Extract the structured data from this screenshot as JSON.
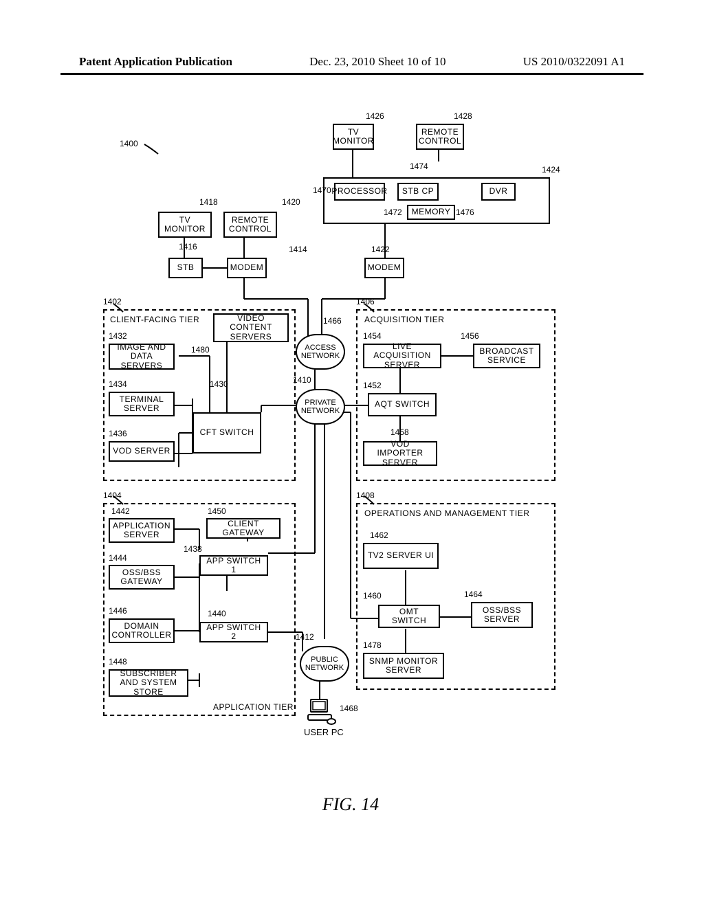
{
  "header": {
    "left": "Patent Application Publication",
    "middle": "Dec. 23, 2010  Sheet 10 of 10",
    "right": "US 2010/0322091 A1"
  },
  "figure_caption": "FIG. 14",
  "refs": {
    "r1400": "1400",
    "r1402": "1402",
    "r1404": "1404",
    "r1406": "1406",
    "r1408": "1408",
    "r1410": "1410",
    "r1412": "1412",
    "r1414": "1414",
    "r1416": "1416",
    "r1418": "1418",
    "r1420": "1420",
    "r1422": "1422",
    "r1424": "1424",
    "r1426": "1426",
    "r1428": "1428",
    "r1430": "1430",
    "r1432": "1432",
    "r1434": "1434",
    "r1436": "1436",
    "r1438": "1438",
    "r1440": "1440",
    "r1442": "1442",
    "r1444": "1444",
    "r1446": "1446",
    "r1448": "1448",
    "r1450": "1450",
    "r1452": "1452",
    "r1454": "1454",
    "r1456": "1456",
    "r1458": "1458",
    "r1460": "1460",
    "r1462": "1462",
    "r1464": "1464",
    "r1466": "1466",
    "r1468": "1468",
    "r1470": "1470",
    "r1472": "1472",
    "r1474": "1474",
    "r1476": "1476",
    "r1478": "1478",
    "r1480": "1480"
  },
  "boxes": {
    "tv_monitor_1": "TV MONITOR",
    "remote_control_1": "REMOTE CONTROL",
    "stb": "STB",
    "modem_1": "MODEM",
    "modem_2": "MODEM",
    "tv_monitor_2": "TV MONITOR",
    "remote_control_2": "REMOTE CONTROL",
    "processor": "PROCESSOR",
    "stb_cp": "STB CP",
    "dvr": "DVR",
    "memory": "MEMORY",
    "video_content_servers": "VIDEO CONTENT SERVERS",
    "image_and_data_servers": "IMAGE AND DATA SERVERS",
    "terminal_server": "TERMINAL SERVER",
    "vod_server": "VOD SERVER",
    "cft_switch": "CFT SWITCH",
    "live_acquisition_server": "LIVE ACQUISITION SERVER",
    "broadcast_service": "BROADCAST SERVICE",
    "aqt_switch": "AQT SWITCH",
    "vod_importer_server": "VOD IMPORTER SERVER",
    "application_server": "APPLICATION SERVER",
    "client_gateway": "CLIENT GATEWAY",
    "oss_bss_gateway": "OSS/BSS GATEWAY",
    "app_switch_1": "APP SWITCH 1",
    "domain_controller": "DOMAIN CONTROLLER",
    "app_switch_2": "APP SWITCH 2",
    "subscriber_and_system_store": "SUBSCRIBER AND SYSTEM STORE",
    "tv2_server_ui": "TV2 SERVER UI",
    "omt_switch": "OMT SWITCH",
    "oss_bss_server": "OSS/BSS SERVER",
    "snmp_monitor_server": "SNMP MONITOR SERVER",
    "user_pc": "USER PC"
  },
  "clouds": {
    "access_network": "ACCESS NETWORK",
    "private_network": "PRIVATE NETWORK",
    "public_network": "PUBLIC NETWORK"
  },
  "tiers": {
    "client_facing": "CLIENT-FACING TIER",
    "acquisition": "ACQUISITION TIER",
    "application": "APPLICATION TIER",
    "operations": "OPERATIONS AND MANAGEMENT TIER"
  }
}
